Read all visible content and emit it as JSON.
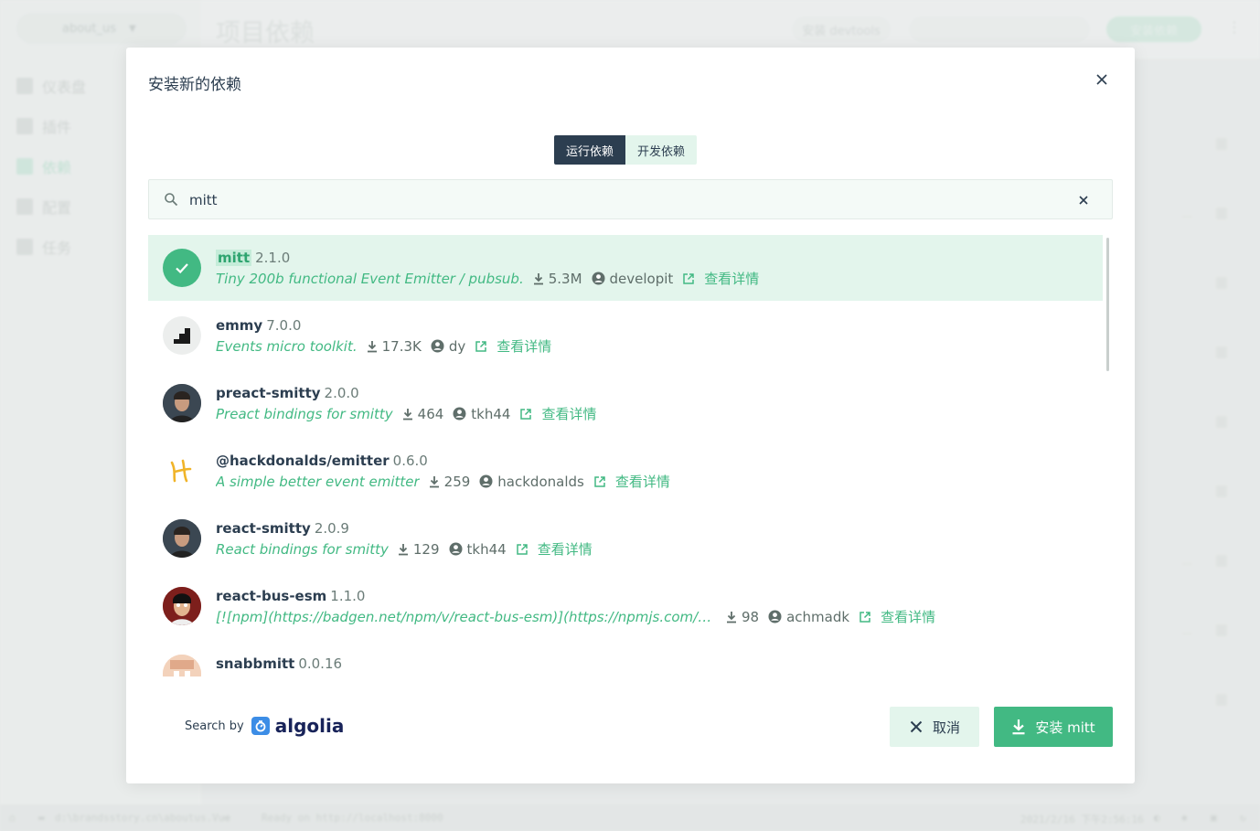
{
  "background": {
    "project_name": "about_us",
    "page_title": "项目依赖",
    "devtools_button": "安装 devtools",
    "install_button": "安装依赖",
    "nav": [
      {
        "label": "仪表盘",
        "icon": "dashboard-icon"
      },
      {
        "label": "插件",
        "icon": "puzzle-icon"
      },
      {
        "label": "依赖",
        "icon": "dependency-icon"
      },
      {
        "label": "配置",
        "icon": "config-icon"
      },
      {
        "label": "任务",
        "icon": "clipboard-icon"
      }
    ],
    "statusbar": {
      "path": "d:\\brandsstory.cn\\aboutus.Vue",
      "log": "Ready on http://localhost:8000",
      "datetime": "2021/2/16 下午2:56:16"
    }
  },
  "modal": {
    "title": "安装新的依赖",
    "tabs": [
      {
        "label": "运行依赖",
        "active": true
      },
      {
        "label": "开发依赖",
        "active": false
      }
    ],
    "search": {
      "value": "mitt",
      "placeholder": ""
    },
    "details_label": "查看详情",
    "results": [
      {
        "name": "mitt",
        "version": "2.1.0",
        "description": "Tiny 200b functional Event Emitter / pubsub.",
        "downloads": "5.3M",
        "author": "developit",
        "selected": true
      },
      {
        "name": "emmy",
        "version": "7.0.0",
        "description": "Events micro toolkit.",
        "downloads": "17.3K",
        "author": "dy",
        "selected": false
      },
      {
        "name": "preact-smitty",
        "version": "2.0.0",
        "description": "Preact bindings for smitty",
        "downloads": "464",
        "author": "tkh44",
        "selected": false
      },
      {
        "name": "@hackdonalds/emitter",
        "version": "0.6.0",
        "description": "A simple better event emitter",
        "downloads": "259",
        "author": "hackdonalds",
        "selected": false
      },
      {
        "name": "react-smitty",
        "version": "2.0.9",
        "description": "React bindings for smitty",
        "downloads": "129",
        "author": "tkh44",
        "selected": false
      },
      {
        "name": "react-bus-esm",
        "version": "1.1.0",
        "description": "[![npm](https://badgen.net/npm/v/react-bus-esm)](https://npmjs.com/package/react-bus-esm)",
        "downloads": "98",
        "author": "achmadk",
        "selected": false
      },
      {
        "name": "snabbmitt",
        "version": "0.0.16",
        "description": "",
        "downloads": "",
        "author": "",
        "selected": false
      }
    ],
    "search_by": "Search by",
    "algolia": "algolia",
    "cancel_label": "取消",
    "install_label": "安装 mitt",
    "colors": {
      "accent": "#42b983",
      "dark": "#2c3e50",
      "light_accent": "#e3f5ec"
    }
  }
}
